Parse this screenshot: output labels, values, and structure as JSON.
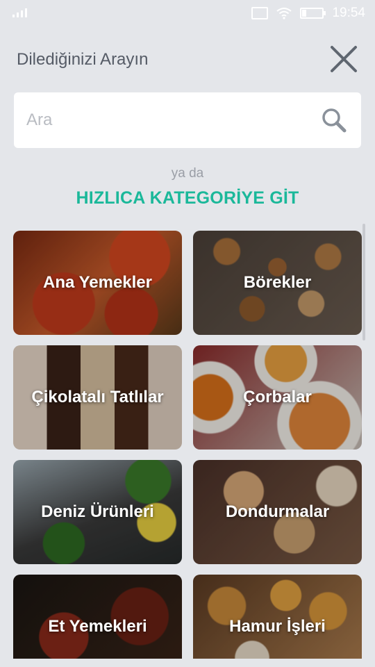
{
  "status_bar": {
    "time": "19:54",
    "icons": [
      "signal-icon",
      "cast-icon",
      "wifi-icon",
      "battery-icon"
    ]
  },
  "header": {
    "title": "Dilediğinizi Arayın",
    "close_icon": "close-icon"
  },
  "search": {
    "placeholder": "Ara",
    "value": "",
    "icon": "search-icon"
  },
  "divider_text": "ya da",
  "quick_category_title": "HIZLICA KATEGORİYE GİT",
  "colors": {
    "background": "#e4e6ea",
    "accent": "#1bb89a",
    "header_text": "#555b66"
  },
  "categories": [
    {
      "label": "Ana Yemekler"
    },
    {
      "label": "Börekler"
    },
    {
      "label": "Çikolatalı Tatlılar"
    },
    {
      "label": "Çorbalar"
    },
    {
      "label": "Deniz Ürünleri"
    },
    {
      "label": "Dondurmalar"
    },
    {
      "label": "Et Yemekleri"
    },
    {
      "label": "Hamur İşleri"
    }
  ]
}
